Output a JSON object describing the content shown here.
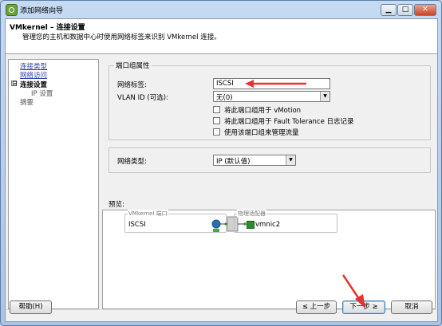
{
  "window": {
    "title": "添加网络向导"
  },
  "header": {
    "title": "VMkernel – 连接设置",
    "description": "管理您的主机和数据中心时使用网络标签来识别 VMkernel 连接。"
  },
  "nav": {
    "items": [
      {
        "label": "连接类型",
        "state": "link"
      },
      {
        "label": "网络访问",
        "state": "link"
      },
      {
        "label": "连接设置",
        "state": "current",
        "marker": "⊟"
      },
      {
        "label": "IP 设置",
        "state": "sub"
      },
      {
        "label": "摘要",
        "state": "plain"
      }
    ]
  },
  "port_group": {
    "title": "端口组属性",
    "network_label": {
      "label": "网络标签:",
      "value": "ISCSI"
    },
    "vlan": {
      "label": "VLAN ID (可选):",
      "value": "无(0)"
    },
    "checkboxes": [
      {
        "label": "将此端口组用于 vMotion",
        "checked": false
      },
      {
        "label": "将此端口组用于 Fault Tolerance 日志记录",
        "checked": false
      },
      {
        "label": "使用该端口组来管理流量",
        "checked": false
      }
    ]
  },
  "network_type": {
    "label": "网络类型:",
    "value": "IP (默认值)"
  },
  "preview": {
    "label": "预览:",
    "vmkernel_port_title": "VMkernel 端口",
    "vmkernel_port_name": "ISCSI",
    "physical_adapter_title": "物理适配器",
    "physical_adapter_name": "vmnic2"
  },
  "footer": {
    "help": "帮助(H)",
    "back": "≤ 上一步",
    "next": "下一步 ≥",
    "cancel": "取消"
  },
  "colors": {
    "annotation_arrow": "#e53333",
    "link": "#3344aa",
    "nic_green": "#2e8b2e"
  }
}
